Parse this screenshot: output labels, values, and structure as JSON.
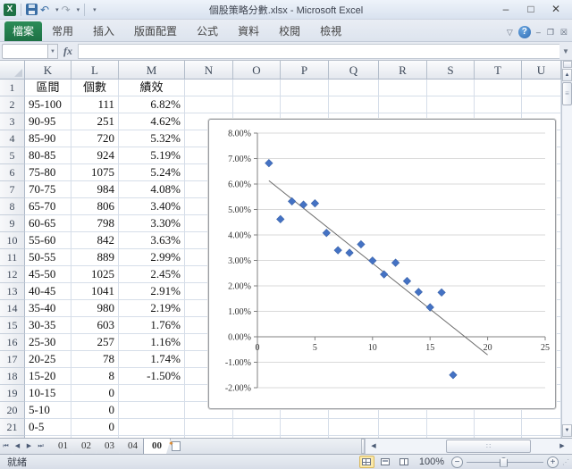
{
  "window": {
    "title": "個股策略分數.xlsx - Microsoft Excel"
  },
  "icons": {
    "excel": "X",
    "undo": "↶",
    "redo": "↷",
    "dropdown": "▾",
    "minimize": "–",
    "maximize": "□",
    "close": "✕",
    "ribbon_collapse": "▽",
    "help": "?",
    "doc_minimize": "–",
    "doc_restore": "❐",
    "doc_close": "☒",
    "formula_chevron": "▼",
    "up_arrow": "▲",
    "down_arrow": "▼",
    "first": "⏮",
    "prev_tab": "◀",
    "next_tab": "▶",
    "last": "⏭",
    "scroll_left": "◀",
    "scroll_right": "▶",
    "thumb_grip": "∷",
    "zoom_out": "−",
    "zoom_in": "+",
    "insert_sheet_spark": "✦",
    "resize_grip": "⋰"
  },
  "ribbon": {
    "file_tab": "檔案",
    "tabs": [
      "常用",
      "插入",
      "版面配置",
      "公式",
      "資料",
      "校閱",
      "檢視"
    ]
  },
  "formula_bar": {
    "name_box": "",
    "fx_label": "fx",
    "value": ""
  },
  "sheet": {
    "columns": [
      "K",
      "L",
      "M",
      "N",
      "O",
      "P",
      "Q",
      "R",
      "S",
      "T",
      "U"
    ],
    "rows": [
      [
        "區間",
        "個數",
        "績效"
      ],
      [
        "95-100",
        "111",
        "6.82%"
      ],
      [
        "90-95",
        "251",
        "4.62%"
      ],
      [
        "85-90",
        "720",
        "5.32%"
      ],
      [
        "80-85",
        "924",
        "5.19%"
      ],
      [
        "75-80",
        "1075",
        "5.24%"
      ],
      [
        "70-75",
        "984",
        "4.08%"
      ],
      [
        "65-70",
        "806",
        "3.40%"
      ],
      [
        "60-65",
        "798",
        "3.30%"
      ],
      [
        "55-60",
        "842",
        "3.63%"
      ],
      [
        "50-55",
        "889",
        "2.99%"
      ],
      [
        "45-50",
        "1025",
        "2.45%"
      ],
      [
        "40-45",
        "1041",
        "2.91%"
      ],
      [
        "35-40",
        "980",
        "2.19%"
      ],
      [
        "30-35",
        "603",
        "1.76%"
      ],
      [
        "25-30",
        "257",
        "1.16%"
      ],
      [
        "20-25",
        "78",
        "1.74%"
      ],
      [
        "15-20",
        "8",
        "-1.50%"
      ],
      [
        "10-15",
        "0",
        ""
      ],
      [
        "5-10",
        "0",
        ""
      ],
      [
        "0-5",
        "0",
        ""
      ],
      [
        "",
        "",
        ""
      ]
    ]
  },
  "chart_data": {
    "type": "scatter",
    "title": "",
    "series": [
      {
        "name": "績效",
        "x": [
          1,
          2,
          3,
          4,
          5,
          6,
          7,
          8,
          9,
          10,
          11,
          12,
          13,
          14,
          15,
          16,
          17
        ],
        "y": [
          6.82,
          4.62,
          5.32,
          5.19,
          5.24,
          4.08,
          3.4,
          3.3,
          3.63,
          2.99,
          2.45,
          2.91,
          2.19,
          1.76,
          1.16,
          1.74,
          -1.5
        ]
      }
    ],
    "trendline": {
      "type": "linear",
      "slope": -0.36,
      "intercept": 6.49,
      "x_start": 1,
      "x_end": 20
    },
    "xlim": [
      0,
      25
    ],
    "ylim": [
      -2,
      8
    ],
    "x_ticks": [
      0,
      5,
      10,
      15,
      20,
      25
    ],
    "y_tick_step": 1,
    "y_tick_suffix": "%",
    "grid": true,
    "legend": false,
    "marker": "diamond",
    "marker_color": "#4472C4",
    "trendline_color": "#6b6b6b",
    "axis_color": "#808080",
    "gridline_color": "#d9d9d9",
    "label_color": "#333333"
  },
  "sheet_tabs": {
    "items": [
      "01",
      "02",
      "03",
      "04",
      "00"
    ],
    "active": "00"
  },
  "status_bar": {
    "ready": "就緒",
    "zoom_level": "100%"
  }
}
